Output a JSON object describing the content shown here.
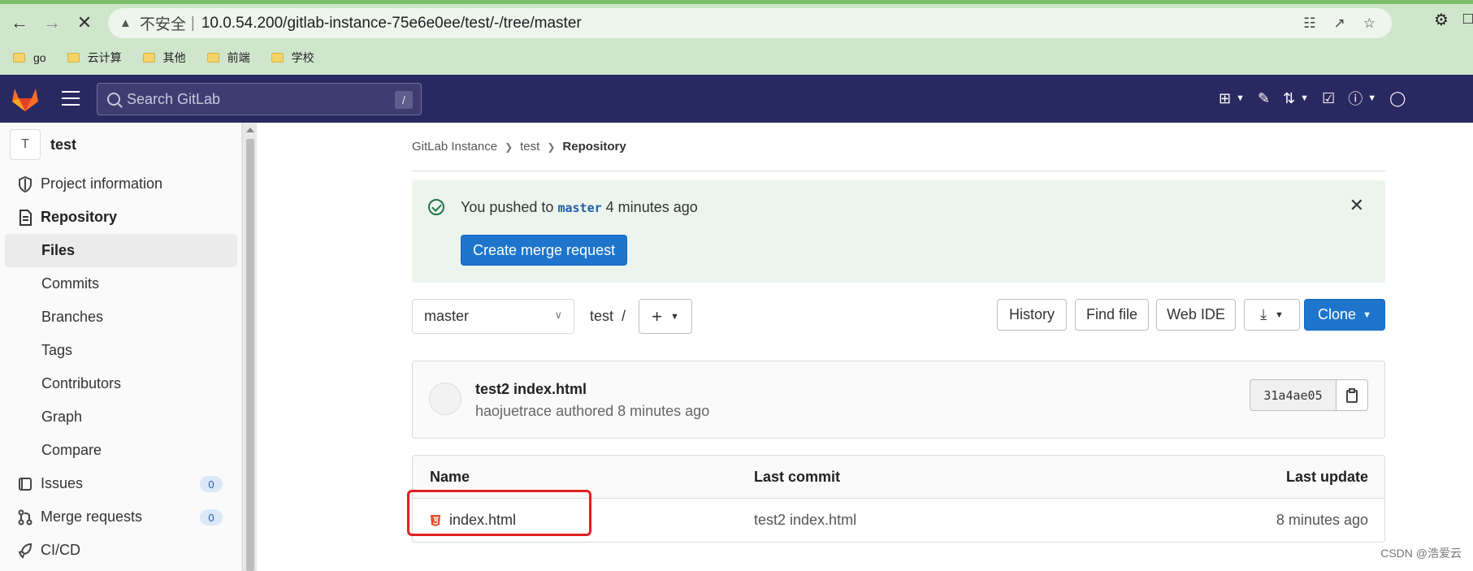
{
  "browser": {
    "insecure_label": "不安全",
    "url": "10.0.54.200/gitlab-instance-75e6e0ee/test/-/tree/master",
    "bookmarks": [
      "go",
      "云计算",
      "其他",
      "前端",
      "学校"
    ]
  },
  "header": {
    "search_placeholder": "Search GitLab",
    "search_shortcut": "/"
  },
  "sidebar": {
    "project_avatar": "T",
    "project_name": "test",
    "items": [
      {
        "label": "Project information"
      },
      {
        "label": "Repository"
      },
      {
        "label": "Files"
      },
      {
        "label": "Commits"
      },
      {
        "label": "Branches"
      },
      {
        "label": "Tags"
      },
      {
        "label": "Contributors"
      },
      {
        "label": "Graph"
      },
      {
        "label": "Compare"
      },
      {
        "label": "Issues",
        "badge": "0"
      },
      {
        "label": "Merge requests",
        "badge": "0"
      },
      {
        "label": "CI/CD"
      }
    ]
  },
  "breadcrumb": [
    "GitLab Instance",
    "test",
    "Repository"
  ],
  "alert": {
    "prefix": "You pushed to",
    "branch": "master",
    "suffix": "4 minutes ago",
    "button": "Create merge request"
  },
  "toolbar": {
    "branch": "master",
    "path": "test  /",
    "history": "History",
    "find_file": "Find file",
    "web_ide": "Web IDE",
    "clone": "Clone"
  },
  "commit": {
    "title": "test2 index.html",
    "meta": "haojuetrace authored 8 minutes ago",
    "sha": "31a4ae05"
  },
  "table": {
    "headers": [
      "Name",
      "Last commit",
      "Last update"
    ],
    "rows": [
      {
        "name": "index.html",
        "last_commit": "test2 index.html",
        "last_update": "8 minutes ago"
      }
    ]
  },
  "watermark": "CSDN @浩爱云&#8203;",
  "colors": {
    "header_bg": "#292961",
    "primary": "#1f75cb",
    "alert_bg": "#ecf4ee",
    "highlight": "#e02020"
  }
}
